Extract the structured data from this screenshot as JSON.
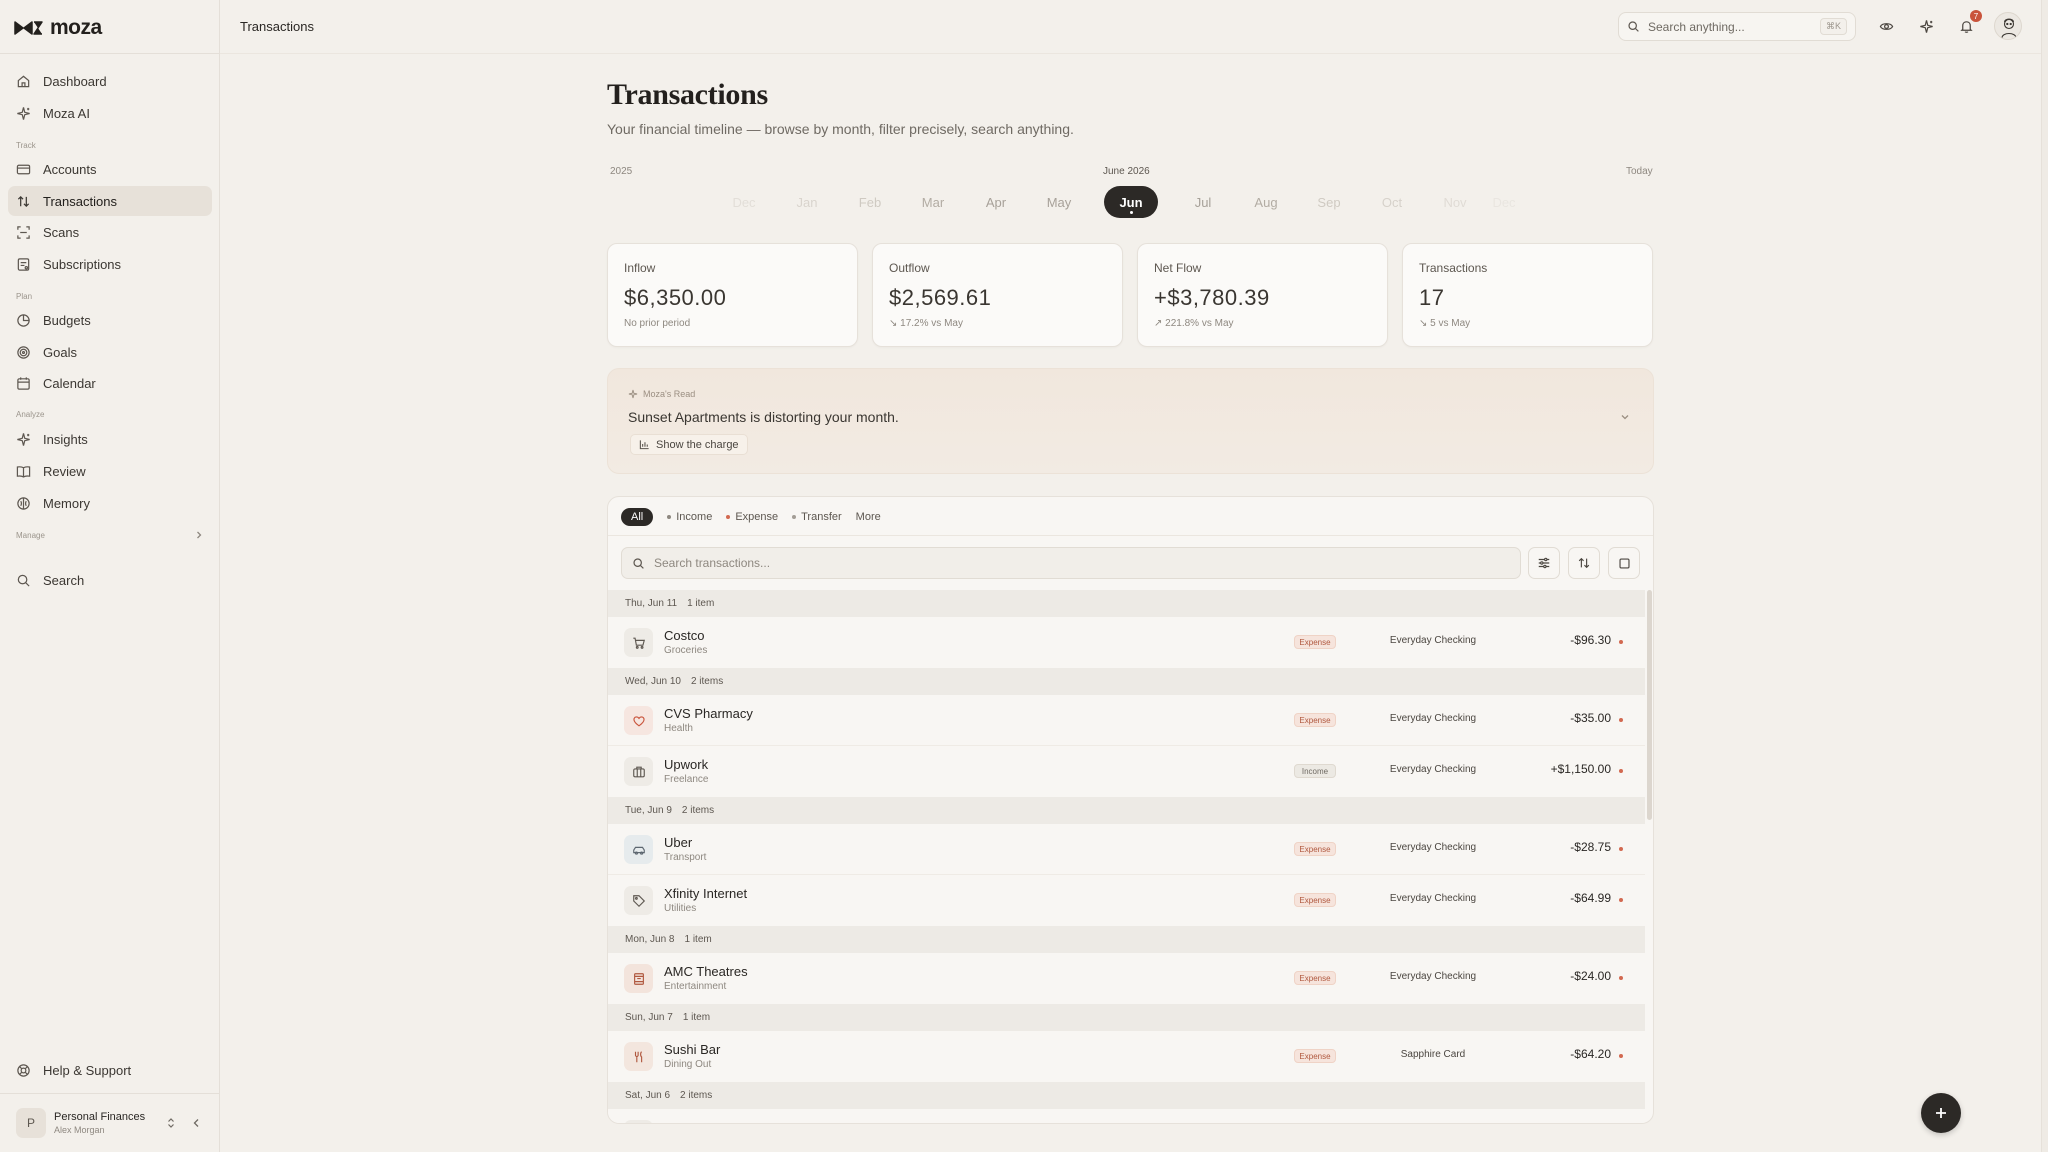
{
  "app": {
    "logo": "moza"
  },
  "sidebar": {
    "items_top": [
      {
        "label": "Dashboard",
        "icon": "home-icon"
      },
      {
        "label": "Moza AI",
        "icon": "sparkle-icon"
      }
    ],
    "sections": [
      {
        "label": "Track",
        "items": [
          {
            "label": "Accounts",
            "icon": "card-icon"
          },
          {
            "label": "Transactions",
            "icon": "arrows-updown-icon",
            "active": true
          },
          {
            "label": "Scans",
            "icon": "scan-icon"
          },
          {
            "label": "Subscriptions",
            "icon": "receipt-icon"
          }
        ]
      },
      {
        "label": "Plan",
        "items": [
          {
            "label": "Budgets",
            "icon": "pie-icon"
          },
          {
            "label": "Goals",
            "icon": "target-icon"
          },
          {
            "label": "Calendar",
            "icon": "calendar-icon"
          }
        ]
      },
      {
        "label": "Analyze",
        "items": [
          {
            "label": "Insights",
            "icon": "sparkle-icon"
          },
          {
            "label": "Review",
            "icon": "book-icon"
          },
          {
            "label": "Memory",
            "icon": "brain-icon"
          }
        ]
      }
    ],
    "manage_label": "Manage",
    "search_label": "Search",
    "help_label": "Help & Support",
    "workspace": {
      "initial": "P",
      "name": "Personal Finances",
      "user": "Alex Morgan"
    }
  },
  "topbar": {
    "title": "Transactions",
    "search_placeholder": "Search anything...",
    "search_shortcut": "⌘K",
    "notification_count": "7"
  },
  "page": {
    "title": "Transactions",
    "subtitle": "Your financial timeline — browse by month, filter precisely, search anything."
  },
  "timeline": {
    "year_label": "2025",
    "current_label": "June 2026",
    "today_label": "Today",
    "months": [
      "Dec",
      "Jan",
      "Feb",
      "Mar",
      "Apr",
      "May",
      "Jun",
      "Jul",
      "Aug",
      "Sep",
      "Oct",
      "Nov",
      "Dec"
    ],
    "selected_index": 6
  },
  "stats": [
    {
      "label": "Inflow",
      "value": "$6,350.00",
      "note": "No prior period"
    },
    {
      "label": "Outflow",
      "value": "$2,569.61",
      "note": "↘ 17.2%  vs May"
    },
    {
      "label": "Net Flow",
      "value": "+$3,780.39",
      "note": "↗ 221.8%  vs May"
    },
    {
      "label": "Transactions",
      "value": "17",
      "note": "↘ 5  vs May"
    }
  ],
  "ai_read": {
    "label": "Moza's Read",
    "headline": "Sunset Apartments is distorting your month.",
    "button": "Show the charge"
  },
  "filters": {
    "all": "All",
    "income": "Income",
    "expense": "Expense",
    "transfer": "Transfer",
    "more": "More",
    "search_placeholder": "Search transactions..."
  },
  "colors": {
    "accent_dark": "#2c2926",
    "income_dot": "#8e8880",
    "expense_dot": "#d26950",
    "transfer_dot": "#a39d95"
  },
  "groups": [
    {
      "date": "Thu, Jun 11",
      "count": "1 item",
      "rows": [
        {
          "name": "Costco",
          "category": "Groceries",
          "type": "Expense",
          "account": "Everyday Checking",
          "amount": "-$96.30",
          "icon": "cart-icon"
        }
      ]
    },
    {
      "date": "Wed, Jun 10",
      "count": "2 items",
      "rows": [
        {
          "name": "CVS Pharmacy",
          "category": "Health",
          "type": "Expense",
          "account": "Everyday Checking",
          "amount": "-$35.00",
          "icon": "heart-icon"
        },
        {
          "name": "Upwork",
          "category": "Freelance",
          "type": "Income",
          "account": "Everyday Checking",
          "amount": "+$1,150.00",
          "icon": "briefcase-icon"
        }
      ]
    },
    {
      "date": "Tue, Jun 9",
      "count": "2 items",
      "rows": [
        {
          "name": "Uber",
          "category": "Transport",
          "type": "Expense",
          "account": "Everyday Checking",
          "amount": "-$28.75",
          "icon": "car-icon"
        },
        {
          "name": "Xfinity Internet",
          "category": "Utilities",
          "type": "Expense",
          "account": "Everyday Checking",
          "amount": "-$64.99",
          "icon": "tag-icon"
        }
      ]
    },
    {
      "date": "Mon, Jun 8",
      "count": "1 item",
      "rows": [
        {
          "name": "AMC Theatres",
          "category": "Entertainment",
          "type": "Expense",
          "account": "Everyday Checking",
          "amount": "-$24.00",
          "icon": "film-icon"
        }
      ]
    },
    {
      "date": "Sun, Jun 7",
      "count": "1 item",
      "rows": [
        {
          "name": "Sushi Bar",
          "category": "Dining Out",
          "type": "Expense",
          "account": "Sapphire Card",
          "amount": "-$64.20",
          "icon": "utensils-icon"
        }
      ]
    },
    {
      "date": "Sat, Jun 6",
      "count": "2 items",
      "rows": []
    }
  ]
}
